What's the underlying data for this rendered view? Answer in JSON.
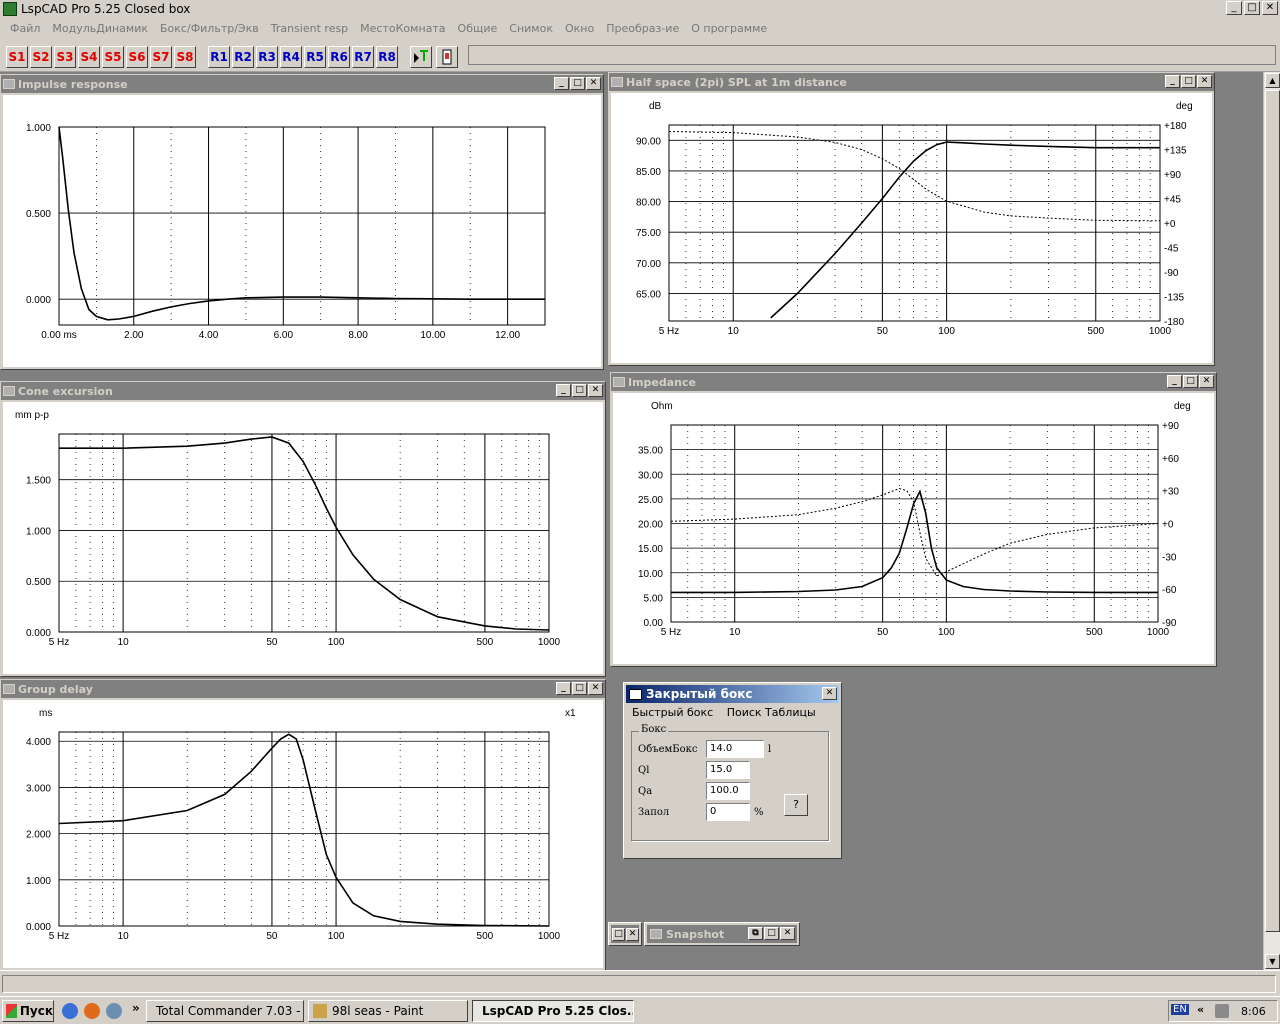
{
  "app": {
    "title": "LspCAD Pro 5.25 Closed box",
    "window_buttons": [
      "_",
      "□",
      "✕"
    ]
  },
  "menu": [
    "Файл",
    "МодульДинамик",
    "Бокс/Фильтр/Экв",
    "Transient resp",
    "МестоКомната",
    "Общие",
    "Снимок",
    "Окно",
    "Преобраз-ие",
    "О программе"
  ],
  "toolbar": {
    "s_buttons": [
      "S1",
      "S2",
      "S3",
      "S4",
      "S5",
      "S6",
      "S7",
      "S8"
    ],
    "r_buttons": [
      "R1",
      "R2",
      "R3",
      "R4",
      "R5",
      "R6",
      "R7",
      "R8"
    ]
  },
  "windows": {
    "impulse": {
      "title": "Impulse response"
    },
    "spl": {
      "title": "Half space (2pi) SPL at 1m distance"
    },
    "cone": {
      "title": "Cone excursion"
    },
    "impedance": {
      "title": "Impedance"
    },
    "group": {
      "title": "Group delay"
    },
    "snapshot": {
      "title": "Snapshot"
    }
  },
  "dialog": {
    "title": "Закрытый бокс",
    "menu": [
      "Быстрый бокс",
      "Поиск Таблицы"
    ],
    "group_label": "Бокс",
    "fields": [
      {
        "label": "ОбъемБокс",
        "value": "14.0",
        "unit": "l"
      },
      {
        "label": "Ql",
        "value": "15.0",
        "unit": ""
      },
      {
        "label": "Qa",
        "value": "100.0",
        "unit": ""
      },
      {
        "label": "Запол",
        "value": "0",
        "unit": "%"
      }
    ],
    "help_button": "?"
  },
  "taskbar": {
    "start": "Пуск",
    "tasks": [
      "Total Commander 7.03 - ...",
      "98l seas - Paint",
      "LspCAD Pro 5.25 Clos..."
    ],
    "lang": "EN",
    "time": "8:06"
  },
  "chart_data": [
    {
      "type": "line",
      "name": "impulse",
      "x_label_first": "0.00 ms",
      "x_ticks": [
        "0.00 ms",
        "2.00",
        "4.00",
        "6.00",
        "8.00",
        "10.00",
        "12.00"
      ],
      "y_ticks": [
        "1.000",
        "0.500",
        "0.000"
      ],
      "xlim": [
        0,
        13
      ],
      "ylim": [
        -0.15,
        1.0
      ],
      "series": [
        {
          "x": [
            0,
            0.1,
            0.25,
            0.4,
            0.6,
            0.8,
            1.0,
            1.3,
            1.6,
            2.0,
            2.5,
            3.0,
            3.5,
            4.0,
            4.5,
            5.0,
            6.0,
            7.0,
            8.0,
            9.0,
            10.0,
            11.0,
            12.0,
            13.0
          ],
          "y": [
            1.0,
            0.82,
            0.52,
            0.27,
            0.06,
            -0.06,
            -0.1,
            -0.12,
            -0.115,
            -0.1,
            -0.07,
            -0.045,
            -0.025,
            -0.01,
            0.0,
            0.008,
            0.012,
            0.012,
            0.008,
            0.004,
            0.002,
            0.0,
            0.0,
            0.0
          ]
        }
      ]
    },
    {
      "type": "line",
      "name": "spl",
      "xscale": "log",
      "x_ticks": [
        "5 Hz",
        "10",
        "50",
        "100",
        "500",
        "1000"
      ],
      "y_ticks": [
        "90.00",
        "85.00",
        "80.00",
        "75.00",
        "70.00",
        "65.00"
      ],
      "y_unit": "dB",
      "y2_unit": "deg",
      "y2_ticks": [
        "+180",
        "+135",
        "+90",
        "+45",
        "+0",
        "-45",
        "-90",
        "-135",
        "-180"
      ],
      "xlim": [
        5,
        1000
      ],
      "ylim": [
        60.5,
        92.5
      ],
      "y2lim": [
        -180,
        180
      ],
      "series": [
        {
          "name": "SPL",
          "x": [
            15,
            20,
            30,
            40,
            50,
            60,
            70,
            80,
            90,
            100,
            120,
            150,
            200,
            300,
            500,
            1000
          ],
          "y": [
            61,
            65,
            71.5,
            76.5,
            80.5,
            84,
            86.6,
            88.3,
            89.3,
            89.7,
            89.6,
            89.4,
            89.2,
            89.0,
            88.8,
            88.8
          ]
        },
        {
          "name": "Phase",
          "style": "dashed",
          "x": [
            5,
            10,
            20,
            30,
            40,
            50,
            60,
            70,
            80,
            100,
            150,
            200,
            300,
            500,
            1000
          ],
          "y": [
            168,
            166,
            158,
            148,
            135,
            118,
            100,
            80,
            62,
            40,
            20,
            13,
            9,
            5,
            4
          ]
        }
      ]
    },
    {
      "type": "line",
      "name": "cone_excursion",
      "xscale": "log",
      "x_ticks": [
        "5 Hz",
        "10",
        "50",
        "100",
        "500",
        "1000"
      ],
      "y_ticks": [
        "1.500",
        "1.000",
        "0.500",
        "0.000"
      ],
      "y_unit": "mm p-p",
      "xlim": [
        5,
        1000
      ],
      "ylim": [
        0,
        1.95
      ],
      "series": [
        {
          "x": [
            5,
            10,
            20,
            30,
            40,
            50,
            60,
            70,
            80,
            90,
            100,
            120,
            150,
            200,
            300,
            500,
            700,
            1000
          ],
          "y": [
            1.81,
            1.81,
            1.83,
            1.86,
            1.9,
            1.92,
            1.86,
            1.68,
            1.45,
            1.22,
            1.03,
            0.76,
            0.52,
            0.32,
            0.15,
            0.06,
            0.03,
            0.02
          ]
        }
      ]
    },
    {
      "type": "line",
      "name": "impedance",
      "xscale": "log",
      "x_ticks": [
        "5 Hz",
        "10",
        "50",
        "100",
        "500",
        "1000"
      ],
      "y_ticks": [
        "35.00",
        "30.00",
        "25.00",
        "20.00",
        "15.00",
        "10.00",
        "5.00",
        "0.00"
      ],
      "y_unit": "Ohm",
      "y2_unit": "deg",
      "y2_ticks": [
        "+90",
        "+60",
        "+30",
        "+0",
        "-30",
        "-60",
        "-90"
      ],
      "xlim": [
        5,
        1000
      ],
      "ylim": [
        0,
        40
      ],
      "y2lim": [
        -90,
        90
      ],
      "series": [
        {
          "name": "Impedance",
          "x": [
            5,
            10,
            20,
            30,
            40,
            50,
            55,
            60,
            65,
            70,
            75,
            80,
            85,
            90,
            100,
            120,
            150,
            200,
            300,
            500,
            1000
          ],
          "y": [
            6.0,
            6.0,
            6.2,
            6.5,
            7.2,
            9.0,
            11,
            14,
            19,
            24,
            26.5,
            22,
            15,
            11,
            8.5,
            7.2,
            6.6,
            6.3,
            6.1,
            6.0,
            6.0
          ]
        },
        {
          "name": "Phase",
          "style": "dashed",
          "x": [
            5,
            10,
            20,
            30,
            40,
            50,
            60,
            65,
            70,
            75,
            80,
            90,
            100,
            150,
            200,
            300,
            500,
            1000
          ],
          "y": [
            2,
            4,
            8,
            14,
            20,
            26,
            32,
            30,
            20,
            -8,
            -32,
            -48,
            -44,
            -28,
            -18,
            -10,
            -4,
            0
          ]
        }
      ]
    },
    {
      "type": "line",
      "name": "group_delay",
      "xscale": "log",
      "x_ticks": [
        "5 Hz",
        "10",
        "50",
        "100",
        "500",
        "1000"
      ],
      "y_ticks": [
        "4.000",
        "3.000",
        "2.000",
        "1.000",
        "0.000"
      ],
      "y_unit": "ms",
      "y2_unit": "x1",
      "xlim": [
        5,
        1000
      ],
      "ylim": [
        0,
        4.2
      ],
      "series": [
        {
          "x": [
            5,
            10,
            20,
            30,
            40,
            50,
            55,
            60,
            65,
            70,
            80,
            90,
            100,
            120,
            150,
            200,
            300,
            500,
            1000
          ],
          "y": [
            2.22,
            2.28,
            2.5,
            2.85,
            3.35,
            3.85,
            4.05,
            4.15,
            4.05,
            3.6,
            2.5,
            1.55,
            1.05,
            0.5,
            0.22,
            0.1,
            0.04,
            0.01,
            0.0
          ]
        }
      ]
    }
  ]
}
